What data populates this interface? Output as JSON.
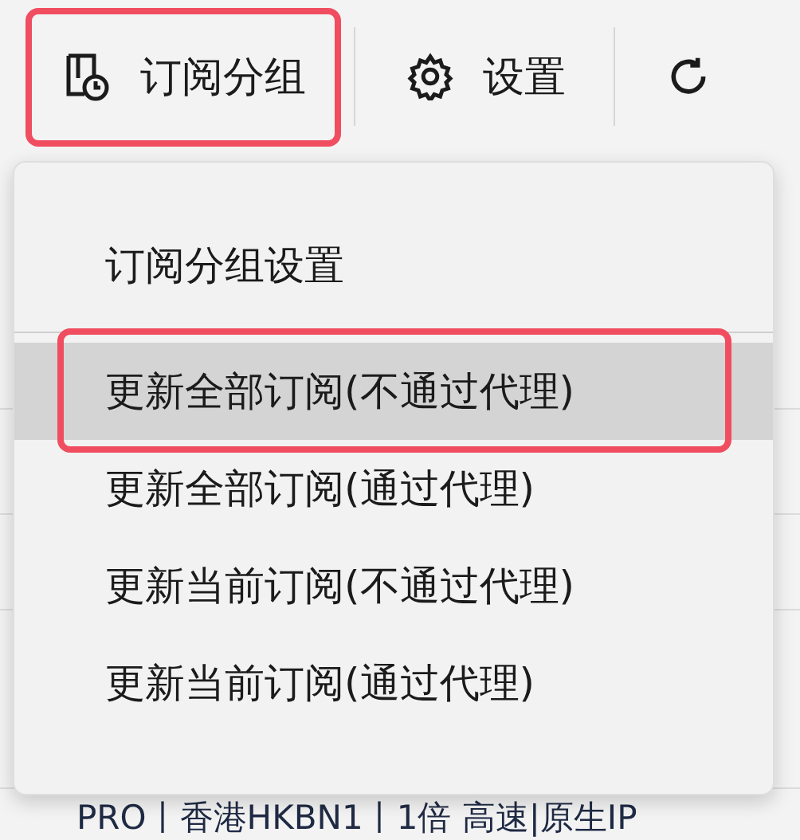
{
  "toolbar": {
    "buttons": [
      {
        "kind": "groups",
        "label": "订阅分组",
        "annotated": true
      },
      {
        "kind": "settings",
        "label": "设置",
        "annotated": false
      },
      {
        "kind": "refresh",
        "annotated": false
      }
    ]
  },
  "menu": {
    "items": [
      {
        "label": "订阅分组设置",
        "selected": false,
        "annotated": false,
        "separator_after": true
      },
      {
        "label": "更新全部订阅(不通过代理)",
        "selected": true,
        "annotated": true,
        "separator_after": false
      },
      {
        "label": "更新全部订阅(通过代理)",
        "selected": false,
        "annotated": false,
        "separator_after": false
      },
      {
        "label": "更新当前订阅(不通过代理)",
        "selected": false,
        "annotated": false,
        "separator_after": false
      },
      {
        "label": "更新当前订阅(通过代理)",
        "selected": false,
        "annotated": false,
        "separator_after": false
      }
    ]
  },
  "list": {
    "rows": [
      {
        "text": "PRO丨香港HKBN1丨1倍 高速|原生IP"
      }
    ]
  }
}
